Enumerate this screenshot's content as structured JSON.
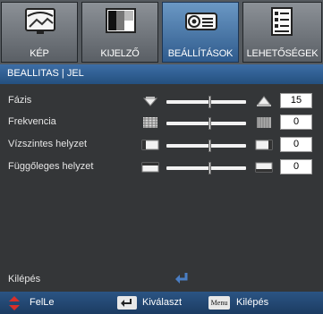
{
  "tabs": [
    {
      "label": "KÉP",
      "icon": "image-icon"
    },
    {
      "label": "KIJELZŐ",
      "icon": "display-icon"
    },
    {
      "label": "BEÁLLÍTÁSOK",
      "icon": "projector-icon",
      "active": true
    },
    {
      "label": "LEHETŐSÉGEK",
      "icon": "options-icon"
    }
  ],
  "section_title": "BEALLITAS | JEL",
  "rows": [
    {
      "label": "Fázis",
      "value": "15",
      "level": 0.55
    },
    {
      "label": "Frekvencia",
      "value": "0",
      "level": 0.55
    },
    {
      "label": "Vízszintes helyzet",
      "value": "0",
      "level": 0.55
    },
    {
      "label": "Függőleges helyzet",
      "value": "0",
      "level": 0.55
    }
  ],
  "exit_label": "Kilépés",
  "footer": {
    "nav_label": "FelLe",
    "select_label": "Kiválaszt",
    "menu_key": "Menu",
    "exit_label": "Kilépés"
  },
  "colors": {
    "accent": "#2f5b8d",
    "exit_arrow": "#4a7ec4",
    "updown_arrow": "#d9302a"
  }
}
